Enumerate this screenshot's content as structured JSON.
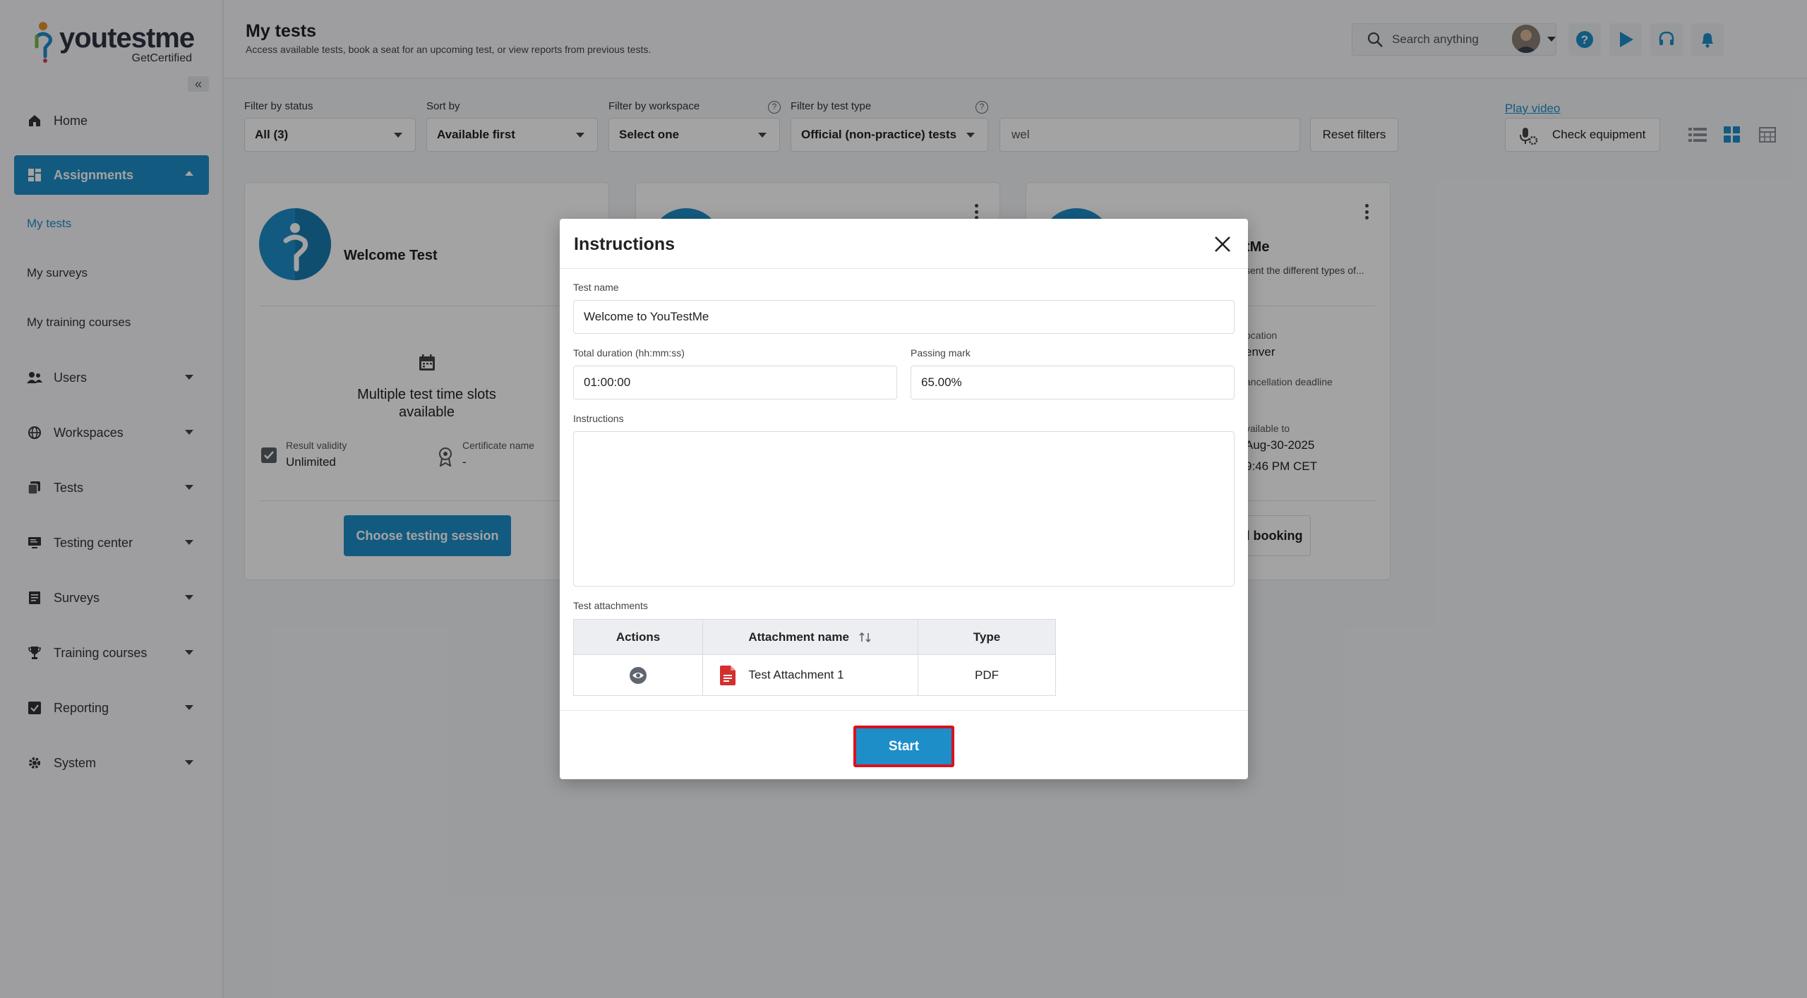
{
  "brand": {
    "word_a": "you",
    "word_b": "test",
    "word_c": "me",
    "sub": "GetCertified"
  },
  "sidebar": {
    "home": "Home",
    "assignments": "Assignments",
    "sub_items": [
      "My tests",
      "My surveys",
      "My training courses"
    ],
    "items": [
      "Users",
      "Workspaces",
      "Tests",
      "Testing center",
      "Surveys",
      "Training courses",
      "Reporting",
      "System"
    ]
  },
  "header": {
    "title": "My tests",
    "subtitle": "Access available tests, book a seat for an upcoming test, or view reports from previous tests.",
    "search_placeholder": "Search anything"
  },
  "filters": {
    "status_label": "Filter by status",
    "status_value": "All (3)",
    "sort_label": "Sort by",
    "sort_value": "Available first",
    "workspace_label": "Filter by workspace",
    "workspace_value": "Select one",
    "type_label": "Filter by test type",
    "type_value": "Official (non-practice) tests",
    "text_value": "wel",
    "reset": "Reset filters",
    "play_video": "Play video",
    "check_equipment": "Check equipment"
  },
  "cards": {
    "card1": {
      "title": "Welcome Test",
      "slots": "Multiple test time slots available",
      "validity_label": "Result validity",
      "validity_value": "Unlimited",
      "cert_label": "Certificate name",
      "cert_value": "-",
      "button": "Choose testing session"
    },
    "card3": {
      "title_frag": "tMe",
      "desc_frag": "sent the different types of...",
      "location_label": "ocation",
      "location_value": "enver",
      "deadline_label": "ancellation deadline",
      "available_label": "vailable to",
      "date": "Aug-30-2025",
      "time": "9:46 PM CET",
      "button": "el booking"
    }
  },
  "modal": {
    "title": "Instructions",
    "test_name_label": "Test name",
    "test_name": "Welcome to YouTestMe",
    "duration_label": "Total duration (hh:mm:ss)",
    "duration": "01:00:00",
    "passing_label": "Passing mark",
    "passing": "65.00%",
    "instructions_label": "Instructions",
    "attachments_label": "Test attachments",
    "columns": [
      "Actions",
      "Attachment name",
      "Type"
    ],
    "rows": [
      {
        "name": "Test Attachment 1",
        "type": "PDF"
      }
    ],
    "start": "Start"
  },
  "colors": {
    "accent": "#1e8ec9",
    "highlight": "#d9121f",
    "pdf": "#d32f2f"
  }
}
